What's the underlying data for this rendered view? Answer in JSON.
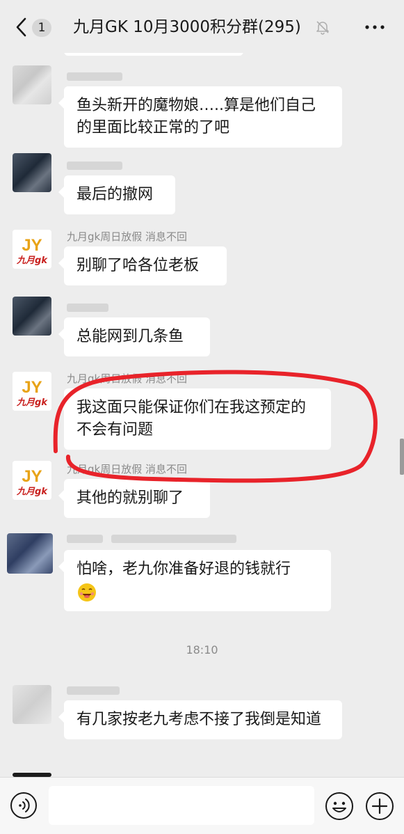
{
  "header": {
    "unread_count": "1",
    "title": "九月GK 10月3000积分群(295)"
  },
  "messages": [
    {
      "sender": "",
      "text": "鱼头新开的魔物娘…..算是他们自己的里面比较正常的了吧"
    },
    {
      "sender": "",
      "text": "最后的撤网"
    },
    {
      "sender": "九月gk周日放假 消息不回",
      "text": "别聊了哈各位老板"
    },
    {
      "sender": "",
      "text": "总能网到几条鱼"
    },
    {
      "sender": "九月gk周日放假 消息不回",
      "text": "我这面只能保证你们在我这预定的 不会有问题"
    },
    {
      "sender": "九月gk周日放假 消息不回",
      "text": "其他的就别聊了"
    },
    {
      "sender": "",
      "text": "怕啥，老九你准备好退的钱就行"
    },
    {
      "sender": "",
      "text": "有几家按老九考虑不接了我倒是知道"
    }
  ],
  "timestamp": "18:10",
  "avatar_logo_text": "九月gk",
  "colors": {
    "background": "#ededed",
    "bubble": "#ffffff",
    "annotation_red": "#e8232a",
    "logo_gold": "#e8a317",
    "logo_red": "#c8201e"
  },
  "icons": [
    "back-arrow-icon",
    "mute-bell-icon",
    "more-dots-icon",
    "voice-icon",
    "emoji-icon",
    "plus-icon",
    "grin-emoji-icon"
  ]
}
